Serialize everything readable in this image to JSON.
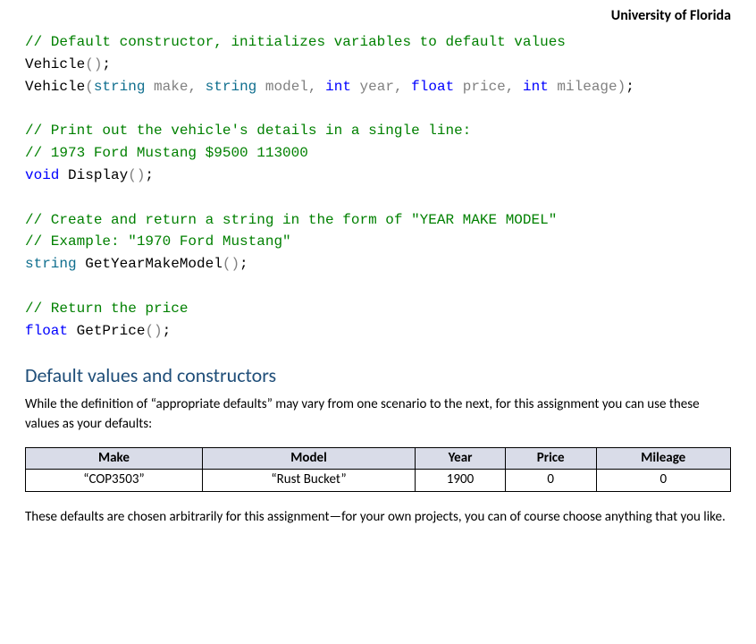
{
  "header": {
    "institution": "University of Florida"
  },
  "code": {
    "cmt_default_ctor": "// Default constructor, initializes variables to default values",
    "vehicle_ctor_default": "Vehicle",
    "open_paren": "()",
    "semi": ";",
    "vehicle_ctor_params_open": "Vehicle",
    "lp": "(",
    "rp": ")",
    "p1_type": "string",
    "p1_name": " make",
    "comma": ",",
    "sp": " ",
    "p2_type": "string",
    "p2_name": " model",
    "p3_type": "int",
    "p3_name": " year",
    "p4_type": "float",
    "p4_name": " price",
    "p5_type": "int",
    "p5_name": " mileage",
    "cmt_print1": "// Print out the vehicle's details in a single line:",
    "cmt_print2": "// 1973 Ford Mustang $9500 113000",
    "void_kw": "void",
    "display_name": " Display",
    "cmt_ymm1": "// Create and return a string in the form of \"YEAR MAKE MODEL\"",
    "cmt_ymm2": "// Example: \"1970 Ford Mustang\"",
    "string_kw": "string",
    "ymm_name": " GetYearMakeModel",
    "cmt_price": "// Return the price",
    "float_kw": "float",
    "price_name": " GetPrice"
  },
  "section": {
    "heading": "Default values and constructors",
    "intro": "While the definition of “appropriate defaults” may vary from one scenario to the next, for this assignment you can use these values as your defaults:",
    "outro": "These defaults are chosen arbitrarily for this assignment—for your own projects, you can of course choose anything that you like."
  },
  "table": {
    "headers": {
      "c0": "Make",
      "c1": "Model",
      "c2": "Year",
      "c3": "Price",
      "c4": "Mileage"
    },
    "row": {
      "c0": "“COP3503”",
      "c1": "“Rust Bucket”",
      "c2": "1900",
      "c3": "0",
      "c4": "0"
    }
  }
}
